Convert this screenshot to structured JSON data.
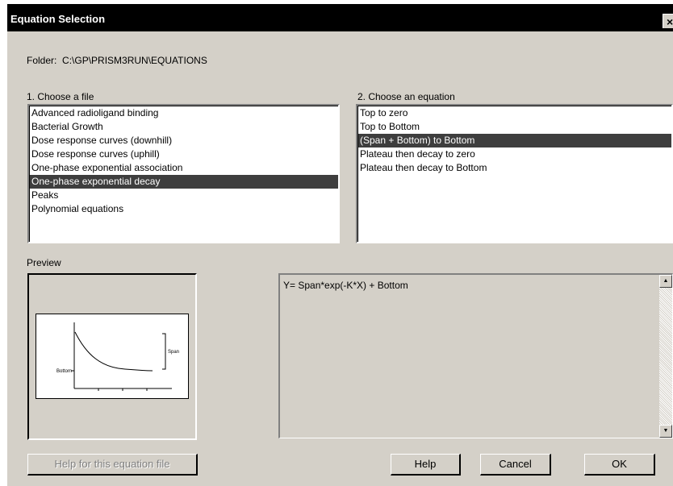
{
  "window": {
    "title": "Equation Selection",
    "close_glyph": "×"
  },
  "folder": {
    "label": "Folder:",
    "path": "C:\\GP\\PRISM3RUN\\EQUATIONS"
  },
  "file_list": {
    "label": "1. Choose a file",
    "items": [
      "Advanced radioligand binding",
      "Bacterial Growth",
      "Dose response curves (downhill)",
      "Dose response curves (uphill)",
      "One-phase exponential association",
      "One-phase exponential decay",
      "Peaks",
      "Polynomial equations"
    ],
    "selected_index": 5
  },
  "equation_list": {
    "label": "2. Choose an equation",
    "items": [
      "Top to zero",
      "Top to Bottom",
      "(Span + Bottom) to Bottom",
      "Plateau then decay to zero",
      "Plateau then decay to Bottom"
    ],
    "selected_index": 2
  },
  "preview": {
    "label": "Preview",
    "graph_labels": {
      "bottom": "Bottom",
      "span": "Span"
    }
  },
  "equation_text": "Y= Span*exp(-K*X) + Bottom",
  "buttons": {
    "help_file": "Help for this equation file",
    "help": "Help",
    "cancel": "Cancel",
    "ok": "OK"
  },
  "scrollbar": {
    "up_glyph": "▲",
    "down_glyph": "▼"
  },
  "colors": {
    "dialog_bg": "#d4d0c8",
    "titlebar_bg": "#000000",
    "selection_bg": "#3e3e3e"
  }
}
